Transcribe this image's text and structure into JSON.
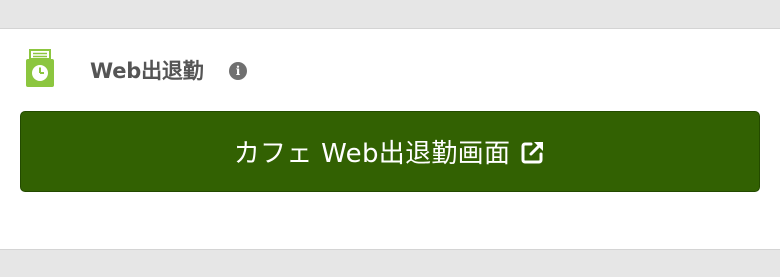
{
  "section": {
    "title": "Web出退勤",
    "info_glyph": "i",
    "icon": "timecard-clock-icon"
  },
  "action_button": {
    "label": "カフェ Web出退勤画面",
    "icon": "external-link-icon"
  },
  "colors": {
    "accent_green": "#8cc63f",
    "button_green": "#326102",
    "title_gray": "#555555",
    "info_gray": "#707070"
  }
}
